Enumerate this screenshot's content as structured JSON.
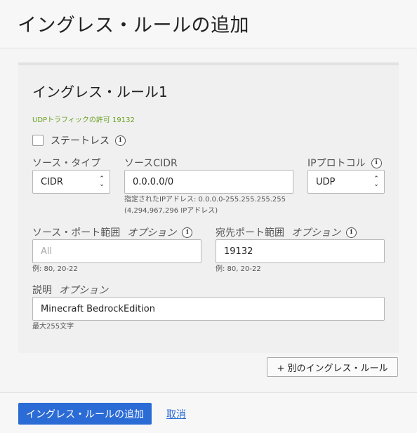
{
  "header": {
    "title": "イングレス・ルールの追加"
  },
  "rule": {
    "title": "イングレス・ルール1",
    "description": "UDPトラフィックの許可 19132",
    "stateless_label": "ステートレス",
    "source_type": {
      "label": "ソース・タイプ",
      "value": "CIDR"
    },
    "source_cidr": {
      "label": "ソースCIDR",
      "value": "0.0.0.0/0",
      "hint_line1": "指定されたIPアドレス: 0.0.0.0-255.255.255.255",
      "hint_line2": "(4,294,967,296 IPアドレス)"
    },
    "ip_protocol": {
      "label": "IPプロトコル",
      "value": "UDP"
    },
    "source_port": {
      "label": "ソース・ポート範囲",
      "optional": "オプション",
      "placeholder": "All",
      "hint": "例: 80, 20-22"
    },
    "dest_port": {
      "label": "宛先ポート範囲",
      "optional": "オプション",
      "value": "19132",
      "hint": "例: 80, 20-22"
    },
    "description_field": {
      "label": "説明",
      "optional": "オプション",
      "value": "Minecraft BedrockEdition",
      "hint": "最大255文字"
    }
  },
  "add_another_label": "+ 別のイングレス・ルール",
  "footer": {
    "submit_label": "イングレス・ルールの追加",
    "cancel_label": "取消"
  },
  "colors": {
    "primary": "#2b6bd6",
    "description_green": "#6aa121"
  },
  "icons": {
    "info": "info-icon",
    "select_arrows": "chevron-up-down-icon"
  }
}
